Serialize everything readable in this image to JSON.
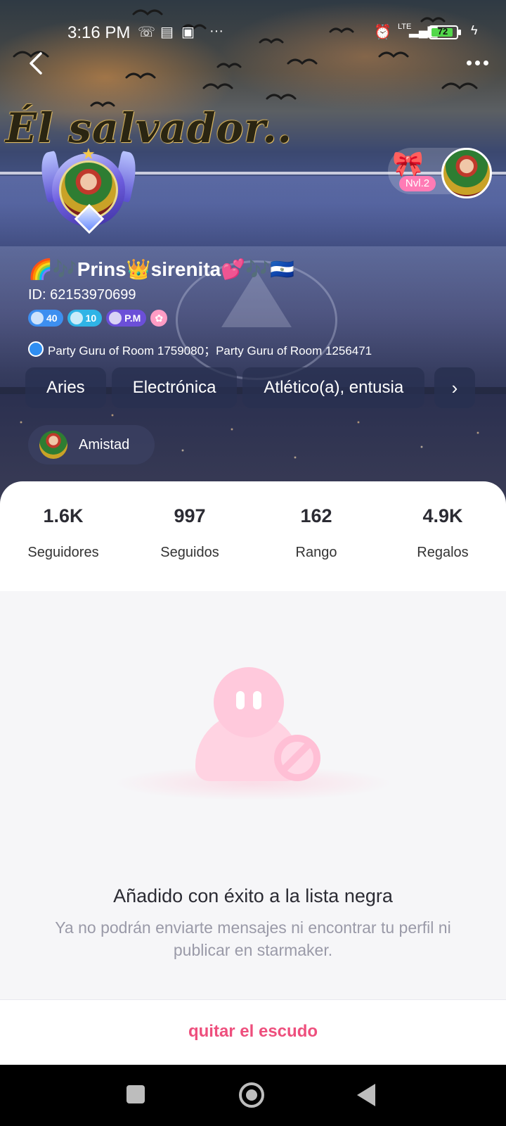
{
  "status_bar": {
    "time": "3:16 PM",
    "network": "LTE",
    "battery_percent": "72"
  },
  "banner": {
    "title": "Él salvador.."
  },
  "profile": {
    "name": "🌈🎶Prins👑sirenita💕🎶🇸🇻",
    "id_text": "ID: 62153970699",
    "badges": [
      {
        "label": "40",
        "icon": "diamond-icon"
      },
      {
        "label": "10",
        "icon": "gem-icon"
      },
      {
        "label": "P.M",
        "icon": "family-icon"
      }
    ],
    "level_badge": "Nvl.2",
    "guru_text": "Party Guru of Room 1759080；Party Guru of Room 1256471",
    "tags": [
      "Aries",
      "Electrónica",
      "Atlético(a), entusia"
    ],
    "relation": "Amistad"
  },
  "stats": [
    {
      "value": "1.6K",
      "label": "Seguidores"
    },
    {
      "value": "997",
      "label": "Seguidos"
    },
    {
      "value": "162",
      "label": "Rango"
    },
    {
      "value": "4.9K",
      "label": "Regalos"
    }
  ],
  "blocked": {
    "title": "Añadido con éxito a la lista negra",
    "subtitle": "Ya no podrán enviarte mensajes ni encontrar tu perfil ni publicar en starmaker.",
    "action": "quitar el escudo"
  },
  "colors": {
    "accent": "#ee4f7d",
    "tag_bg": "#283050",
    "stat_text": "#2b2b33"
  }
}
